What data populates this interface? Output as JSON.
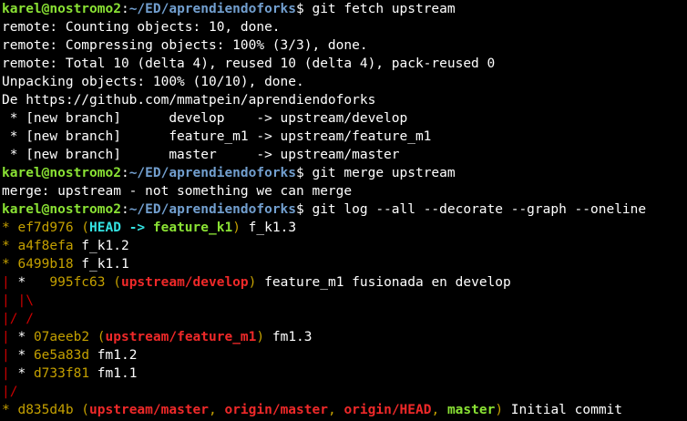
{
  "window": {
    "background": "#000000"
  },
  "colors": {
    "default": "#ffffff",
    "prompt_user": "#8ae234",
    "prompt_path": "#729fcf",
    "hash": "#c4a000",
    "head": "#34e2e2",
    "local_branch": "#8ae234",
    "remote_branch": "#ef2929",
    "graph_red": "#cc0000"
  },
  "terminal": {
    "lines": [
      {
        "segments": [
          {
            "text": "karel@nostromo2",
            "color": "prompt_user",
            "bold": true
          },
          {
            "text": ":",
            "color": "default"
          },
          {
            "text": "~/ED/aprendiendoforks",
            "color": "prompt_path",
            "bold": true
          },
          {
            "text": "$ git fetch upstream",
            "color": "default"
          }
        ]
      },
      {
        "segments": [
          {
            "text": "remote: Counting objects: 10, done.",
            "color": "default"
          }
        ]
      },
      {
        "segments": [
          {
            "text": "remote: Compressing objects: 100% (3/3), done.",
            "color": "default"
          }
        ]
      },
      {
        "segments": [
          {
            "text": "remote: Total 10 (delta 4), reused 10 (delta 4), pack-reused 0",
            "color": "default"
          }
        ]
      },
      {
        "segments": [
          {
            "text": "Unpacking objects: 100% (10/10), done.",
            "color": "default"
          }
        ]
      },
      {
        "segments": [
          {
            "text": "De https://github.com/mmatpein/aprendiendoforks",
            "color": "default"
          }
        ]
      },
      {
        "segments": [
          {
            "text": " * [new branch]      develop    -> upstream/develop",
            "color": "default"
          }
        ]
      },
      {
        "segments": [
          {
            "text": " * [new branch]      feature_m1 -> upstream/feature_m1",
            "color": "default"
          }
        ]
      },
      {
        "segments": [
          {
            "text": " * [new branch]      master     -> upstream/master",
            "color": "default"
          }
        ]
      },
      {
        "segments": [
          {
            "text": "karel@nostromo2",
            "color": "prompt_user",
            "bold": true
          },
          {
            "text": ":",
            "color": "default"
          },
          {
            "text": "~/ED/aprendiendoforks",
            "color": "prompt_path",
            "bold": true
          },
          {
            "text": "$ git merge upstream",
            "color": "default"
          }
        ]
      },
      {
        "segments": [
          {
            "text": "merge: upstream - not something we can merge",
            "color": "default"
          }
        ]
      },
      {
        "segments": [
          {
            "text": "karel@nostromo2",
            "color": "prompt_user",
            "bold": true
          },
          {
            "text": ":",
            "color": "default"
          },
          {
            "text": "~/ED/aprendiendoforks",
            "color": "prompt_path",
            "bold": true
          },
          {
            "text": "$ git log --all --decorate --graph --oneline",
            "color": "default"
          }
        ]
      },
      {
        "segments": [
          {
            "text": "* ",
            "color": "hash"
          },
          {
            "text": "ef7d976 (",
            "color": "hash"
          },
          {
            "text": "HEAD -> ",
            "color": "head",
            "bold": true
          },
          {
            "text": "feature_k1",
            "color": "local_branch",
            "bold": true
          },
          {
            "text": ")",
            "color": "hash"
          },
          {
            "text": " f_k1.3",
            "color": "default"
          }
        ]
      },
      {
        "segments": [
          {
            "text": "* ",
            "color": "hash"
          },
          {
            "text": "a4f8efa",
            "color": "hash"
          },
          {
            "text": " f_k1.2",
            "color": "default"
          }
        ]
      },
      {
        "segments": [
          {
            "text": "* ",
            "color": "hash"
          },
          {
            "text": "6499b18",
            "color": "hash"
          },
          {
            "text": " f_k1.1",
            "color": "default"
          }
        ]
      },
      {
        "segments": [
          {
            "text": "| ",
            "color": "graph_red"
          },
          {
            "text": "*   ",
            "color": "default"
          },
          {
            "text": "995fc63 (",
            "color": "hash"
          },
          {
            "text": "upstream/develop",
            "color": "remote_branch",
            "bold": true
          },
          {
            "text": ")",
            "color": "hash"
          },
          {
            "text": " feature_m1 fusionada en develop",
            "color": "default"
          }
        ]
      },
      {
        "segments": [
          {
            "text": "| |\\",
            "color": "graph_red"
          }
        ]
      },
      {
        "segments": [
          {
            "text": "|/ /",
            "color": "graph_red"
          }
        ]
      },
      {
        "segments": [
          {
            "text": "| ",
            "color": "graph_red"
          },
          {
            "text": "* ",
            "color": "default"
          },
          {
            "text": "07aeeb2 (",
            "color": "hash"
          },
          {
            "text": "upstream/feature_m1",
            "color": "remote_branch",
            "bold": true
          },
          {
            "text": ")",
            "color": "hash"
          },
          {
            "text": " fm1.3",
            "color": "default"
          }
        ]
      },
      {
        "segments": [
          {
            "text": "| ",
            "color": "graph_red"
          },
          {
            "text": "* ",
            "color": "default"
          },
          {
            "text": "6e5a83d",
            "color": "hash"
          },
          {
            "text": " fm1.2",
            "color": "default"
          }
        ]
      },
      {
        "segments": [
          {
            "text": "| ",
            "color": "graph_red"
          },
          {
            "text": "* ",
            "color": "default"
          },
          {
            "text": "d733f81",
            "color": "hash"
          },
          {
            "text": " fm1.1",
            "color": "default"
          }
        ]
      },
      {
        "segments": [
          {
            "text": "|/",
            "color": "graph_red"
          }
        ]
      },
      {
        "segments": [
          {
            "text": "* ",
            "color": "hash"
          },
          {
            "text": "d835d4b (",
            "color": "hash"
          },
          {
            "text": "upstream/master",
            "color": "remote_branch",
            "bold": true
          },
          {
            "text": ", ",
            "color": "hash"
          },
          {
            "text": "origin/master",
            "color": "remote_branch",
            "bold": true
          },
          {
            "text": ", ",
            "color": "hash"
          },
          {
            "text": "origin/HEAD",
            "color": "remote_branch",
            "bold": true
          },
          {
            "text": ", ",
            "color": "hash"
          },
          {
            "text": "master",
            "color": "local_branch",
            "bold": true
          },
          {
            "text": ")",
            "color": "hash"
          },
          {
            "text": " Initial commit",
            "color": "default"
          }
        ]
      }
    ]
  }
}
